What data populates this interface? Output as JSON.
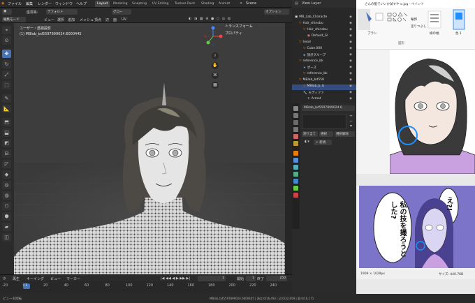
{
  "blender": {
    "menu": [
      "ファイル",
      "編集",
      "レンダー",
      "ウィンドウ",
      "ヘルプ"
    ],
    "workspaces": [
      "Layout",
      "Modeling",
      "Sculpting",
      "UV Editing",
      "Texture Paint",
      "Shading",
      "Animat"
    ],
    "active_workspace": "Layout",
    "scene": "Scene",
    "view_layer": "View Layer",
    "header2": {
      "mode_label": "座標系:",
      "mode_value": "デフォルト",
      "orient": "グロー",
      "options": "オプション"
    },
    "header3": {
      "edit_mode": "編集モード",
      "menu": [
        "ビュー",
        "選択",
        "追加",
        "メッシュ",
        "頂点",
        "辺",
        "面",
        "UV"
      ]
    },
    "viewport": {
      "line1": "ユーザー・透視投影",
      "line2": "(1) MBlab_bd5597899024.6000445",
      "npanel": [
        "トランスフォーム",
        "プロパティ"
      ]
    },
    "timeline": {
      "menu": [
        "再生",
        "キーイング",
        "ビュー",
        "マーカー"
      ],
      "current_frame": "1",
      "start_label": "開始",
      "start": "1",
      "end_label": "終了",
      "end": "250",
      "ticks": [
        "-20",
        "0",
        "20",
        "40",
        "60",
        "80",
        "100",
        "120",
        "140",
        "160",
        "180",
        "200",
        "220",
        "240"
      ]
    },
    "statusbar_left": "ビューを回転",
    "statusbar_right": "MBlab_bd5597899024.6000445 | 頂点:0/16,492 | 辺:0/32,659 | 面:0/16,171",
    "outliner": [
      {
        "label": "MB_Lab_Characte",
        "indent": 0,
        "icon": "collection"
      },
      {
        "label": "Hair_shinobu",
        "indent": 1,
        "icon": "mesh"
      },
      {
        "label": "Hair_shinobu",
        "indent": 2,
        "icon": "mesh"
      },
      {
        "label": "Default_Gl",
        "indent": 3,
        "icon": "material"
      },
      {
        "label": "head",
        "indent": 1,
        "icon": "mesh"
      },
      {
        "label": "Cube.000",
        "indent": 2,
        "icon": "mesh"
      },
      {
        "label": "頂点グループ",
        "indent": 2,
        "icon": "group"
      },
      {
        "label": "reference_bk",
        "indent": 1,
        "icon": "mesh"
      },
      {
        "label": "ポーズ",
        "indent": 2,
        "icon": "pose"
      },
      {
        "label": "reference_bk",
        "indent": 2,
        "icon": "mesh"
      },
      {
        "label": "MBlab_bd559",
        "indent": 1,
        "icon": "mesh"
      },
      {
        "label": "MBlab_b_ls",
        "indent": 2,
        "icon": "mesh",
        "selected": true
      },
      {
        "label": "モディファ",
        "indent": 2,
        "icon": "wrench"
      },
      {
        "label": "Armat",
        "indent": 3,
        "icon": "armature"
      }
    ],
    "properties": {
      "object_name": "MBlab_bd5597899024.6",
      "shape_key_buttons": [
        "割り当て",
        "選択",
        "選択解除"
      ],
      "new_button": "新規"
    }
  },
  "paint": {
    "title": "さんの髪でいいか試すやつ.jpg - ペイント",
    "ribbon": {
      "brush": "ブラシ",
      "shapes": "図形",
      "outline": "輪郭",
      "fill": "塗りつぶし",
      "size": "線の幅",
      "color": "色 1"
    },
    "status_size": "1909 × 1029px",
    "status_file": "サイズ: 440.7KB"
  },
  "manga": {
    "bubble_left": "私の技を撮ろうとした?",
    "bubble_right": "え?!"
  },
  "colors": {
    "accent": "#4772b3",
    "paint_blue": "#1e90ff",
    "manga_bg": "#7b74c8"
  }
}
